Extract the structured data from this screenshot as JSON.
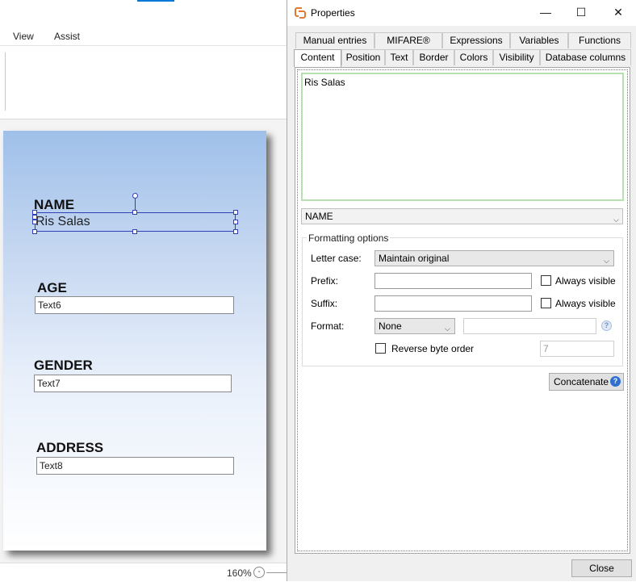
{
  "app": {
    "menu": [
      "View",
      "Assist"
    ],
    "zoom": "160%",
    "zoom_minus": "-"
  },
  "card": {
    "name_label": "NAME",
    "name_value": "Ris Salas",
    "age_label": "AGE",
    "age_field": "Text6",
    "gender_label": "GENDER",
    "gender_field": "Text7",
    "address_label": "ADDRESS",
    "address_field": "Text8"
  },
  "dialog": {
    "title": "Properties",
    "window_controls": {
      "minimize": "—",
      "maximize": "☐",
      "close": "✕"
    },
    "tabs_row1": [
      "Manual entries",
      "MIFARE®",
      "Expressions",
      "Variables",
      "Functions"
    ],
    "tabs_row2": [
      "Content",
      "Position",
      "Text",
      "Border",
      "Colors",
      "Visibility",
      "Database columns"
    ],
    "active_tab": "Content",
    "content_text": "Ris Salas",
    "source_field": "NAME",
    "formatting": {
      "legend": "Formatting options",
      "letter_case_label": "Letter case:",
      "letter_case_value": "Maintain original",
      "prefix_label": "Prefix:",
      "prefix_value": "",
      "suffix_label": "Suffix:",
      "suffix_value": "",
      "always_visible_label": "Always visible",
      "format_label": "Format:",
      "format_value": "None",
      "format_text": "",
      "reverse_label": "Reverse byte order",
      "reverse_value": "7"
    },
    "concatenate_label": "Concatenate",
    "close_label": "Close"
  }
}
